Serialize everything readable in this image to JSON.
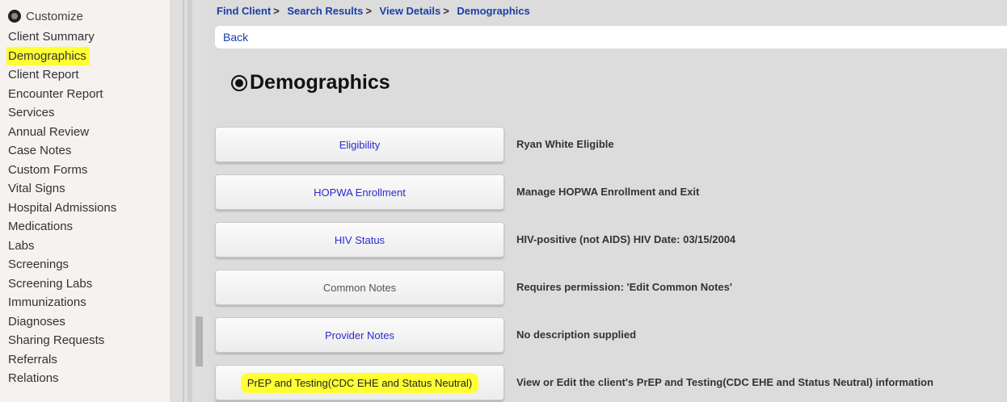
{
  "sidebar": {
    "header": "Customize",
    "items": [
      "Client Summary",
      "Demographics",
      "Client Report",
      "Encounter Report",
      "Services",
      "Annual Review",
      "Case Notes",
      "Custom Forms",
      "Vital Signs",
      "Hospital Admissions",
      "Medications",
      "Labs",
      "Screenings",
      "Screening Labs",
      "Immunizations",
      "Diagnoses",
      "Sharing Requests",
      "Referrals",
      "Relations"
    ],
    "highlight_color": "#ffff33"
  },
  "breadcrumb": {
    "items": [
      "Find Client",
      "Search Results",
      "View Details",
      "Demographics"
    ],
    "separator": ">"
  },
  "back_label": "Back",
  "page_title": "Demographics",
  "rows": [
    {
      "button": "Eligibility",
      "description": "Ryan White Eligible"
    },
    {
      "button": "HOPWA Enrollment",
      "description": "Manage HOPWA Enrollment and Exit"
    },
    {
      "button": "HIV Status",
      "description": "HIV-positive (not AIDS) HIV Date: 03/15/2004"
    },
    {
      "button": "Common Notes",
      "description": "Requires permission: 'Edit Common Notes'"
    },
    {
      "button": "Provider Notes",
      "description": "No description supplied"
    },
    {
      "button": "PrEP and Testing(CDC EHE and Status Neutral)",
      "description": "View or Edit the client's PrEP and Testing(CDC EHE and Status Neutral) information"
    }
  ],
  "colors": {
    "link": "#1a3fa8",
    "button_text": "#2a2ad0",
    "main_bg": "#dcdcdc",
    "sidebar_bg": "#f5f2ef"
  }
}
